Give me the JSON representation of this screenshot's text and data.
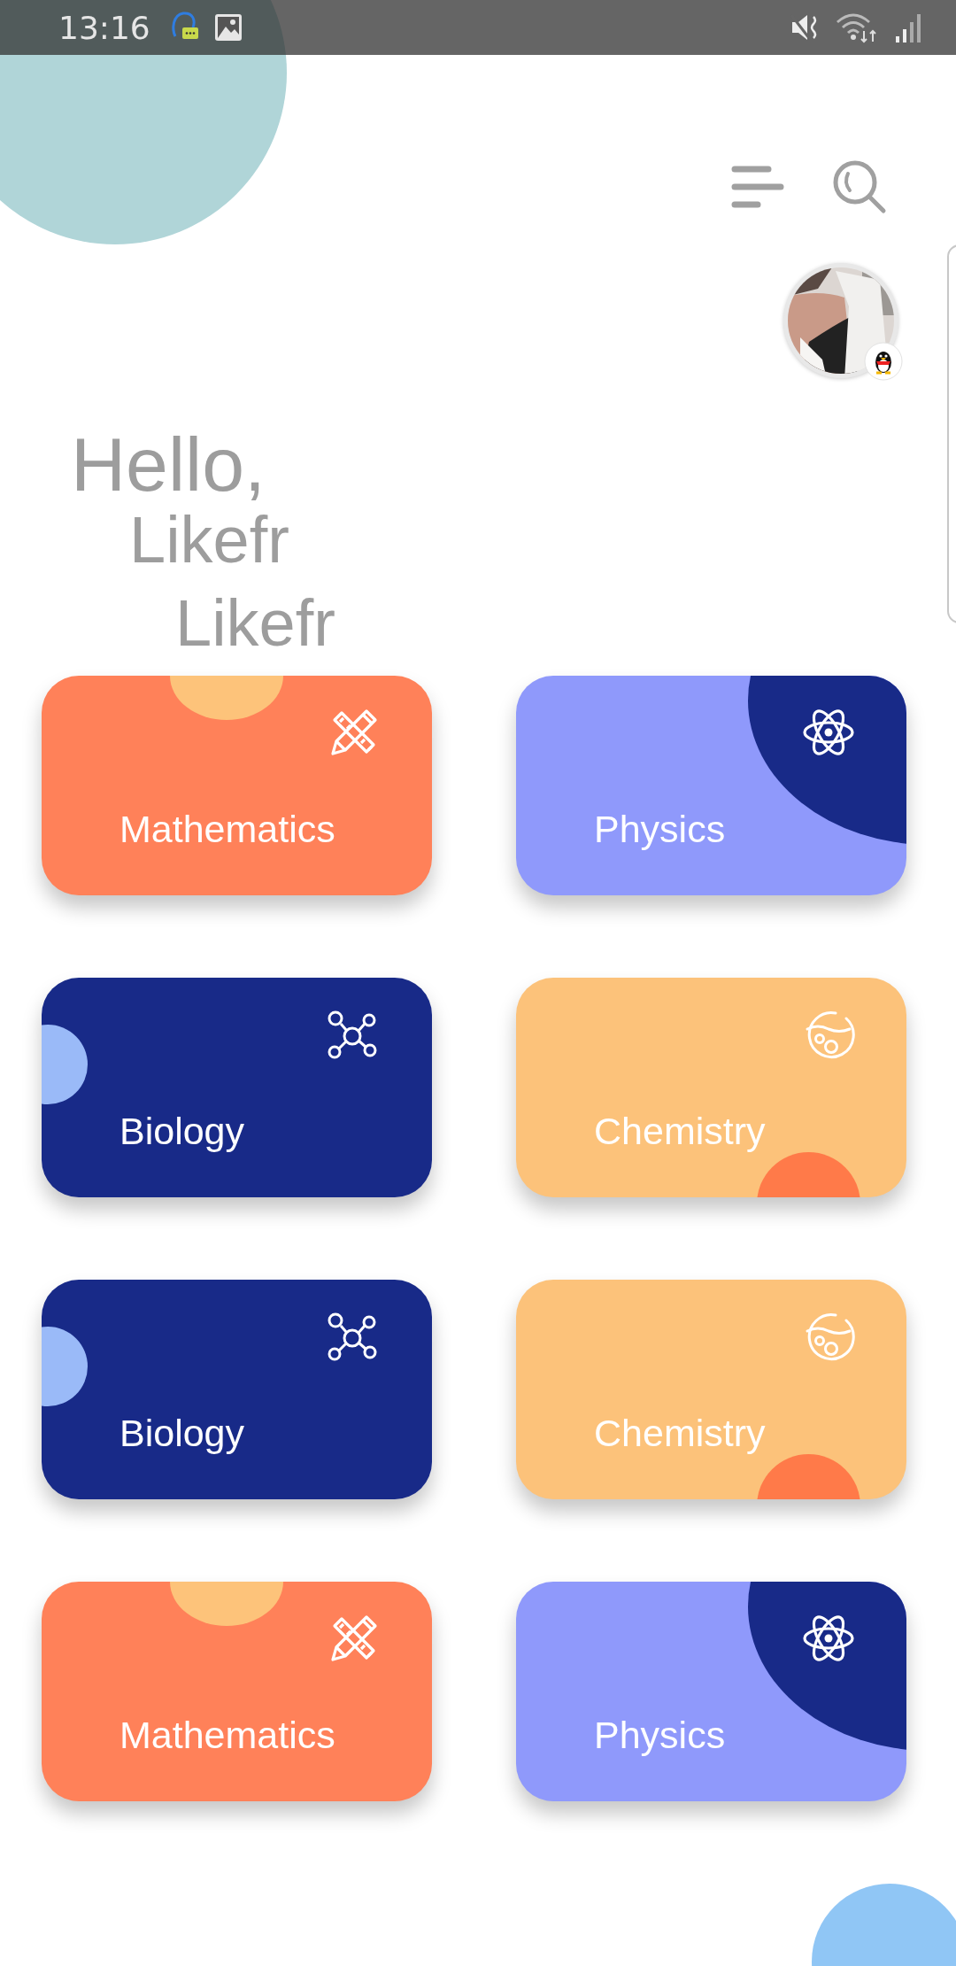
{
  "status_bar": {
    "time": "13:16"
  },
  "greeting": {
    "title": "Hello,",
    "lines": [
      "Likefr",
      "Likefr"
    ]
  },
  "cards": [
    {
      "label": "Mathematics",
      "kind": "math"
    },
    {
      "label": "Physics",
      "kind": "physics"
    },
    {
      "label": "Biology",
      "kind": "biology"
    },
    {
      "label": "Chemistry",
      "kind": "chemistry"
    },
    {
      "label": "Biology",
      "kind": "biology"
    },
    {
      "label": "Chemistry",
      "kind": "chemistry"
    },
    {
      "label": "Mathematics",
      "kind": "math"
    },
    {
      "label": "Physics",
      "kind": "physics"
    }
  ]
}
